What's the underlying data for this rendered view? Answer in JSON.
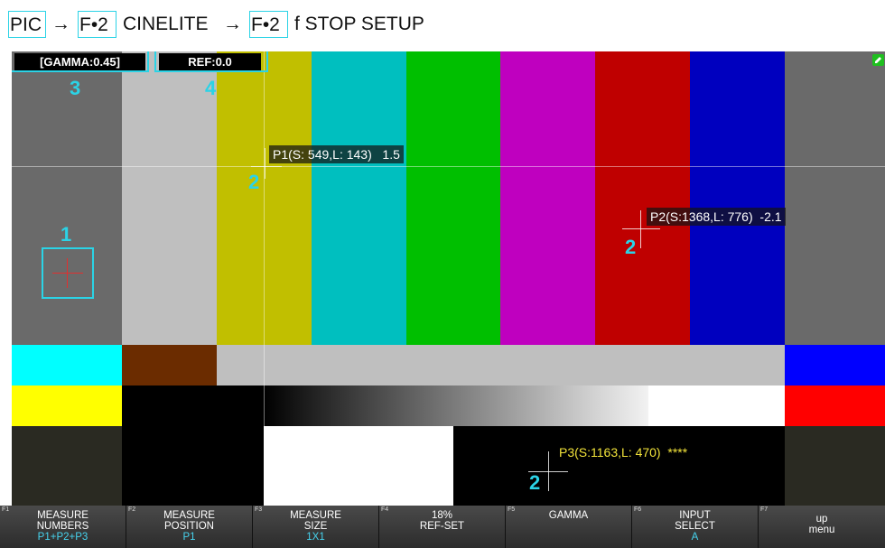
{
  "breadcrumb": {
    "items": [
      "PIC",
      "→",
      "F•2",
      "CINELITE",
      "→",
      "F•2",
      "f STOP SETUP"
    ]
  },
  "status": {
    "gamma": "[GAMMA:0.45]",
    "ref": "REF:0.0"
  },
  "callouts": {
    "c1": "1",
    "c2": "2",
    "c3": "3",
    "c4": "4"
  },
  "readouts": {
    "p1": "P1(S: 549,L: 143)   1.5",
    "p2": "P2(S:1368,L: 776)  -2.1",
    "p3": "P3(S:1163,L: 470)  ****"
  },
  "colors": {
    "accent": "#2bd3e6",
    "p3_text": "#f2e33a"
  },
  "function_keys": [
    {
      "num": "F1",
      "line1": "MEASURE",
      "line2": "NUMBERS",
      "value": "P1+P2+P3"
    },
    {
      "num": "F2",
      "line1": "MEASURE",
      "line2": "POSITION",
      "value": "P1"
    },
    {
      "num": "F3",
      "line1": "MEASURE",
      "line2": "SIZE",
      "value": "1X1"
    },
    {
      "num": "F4",
      "line1": "18%",
      "line2": "REF-SET",
      "value": ""
    },
    {
      "num": "F5",
      "line1": "GAMMA",
      "line2": "",
      "value": ""
    },
    {
      "num": "F6",
      "line1": "INPUT",
      "line2": "SELECT",
      "value": "A"
    },
    {
      "num": "F7",
      "line1": "up",
      "line2": "menu",
      "value": ""
    }
  ],
  "icons": {
    "pencil": "pencil-icon"
  }
}
